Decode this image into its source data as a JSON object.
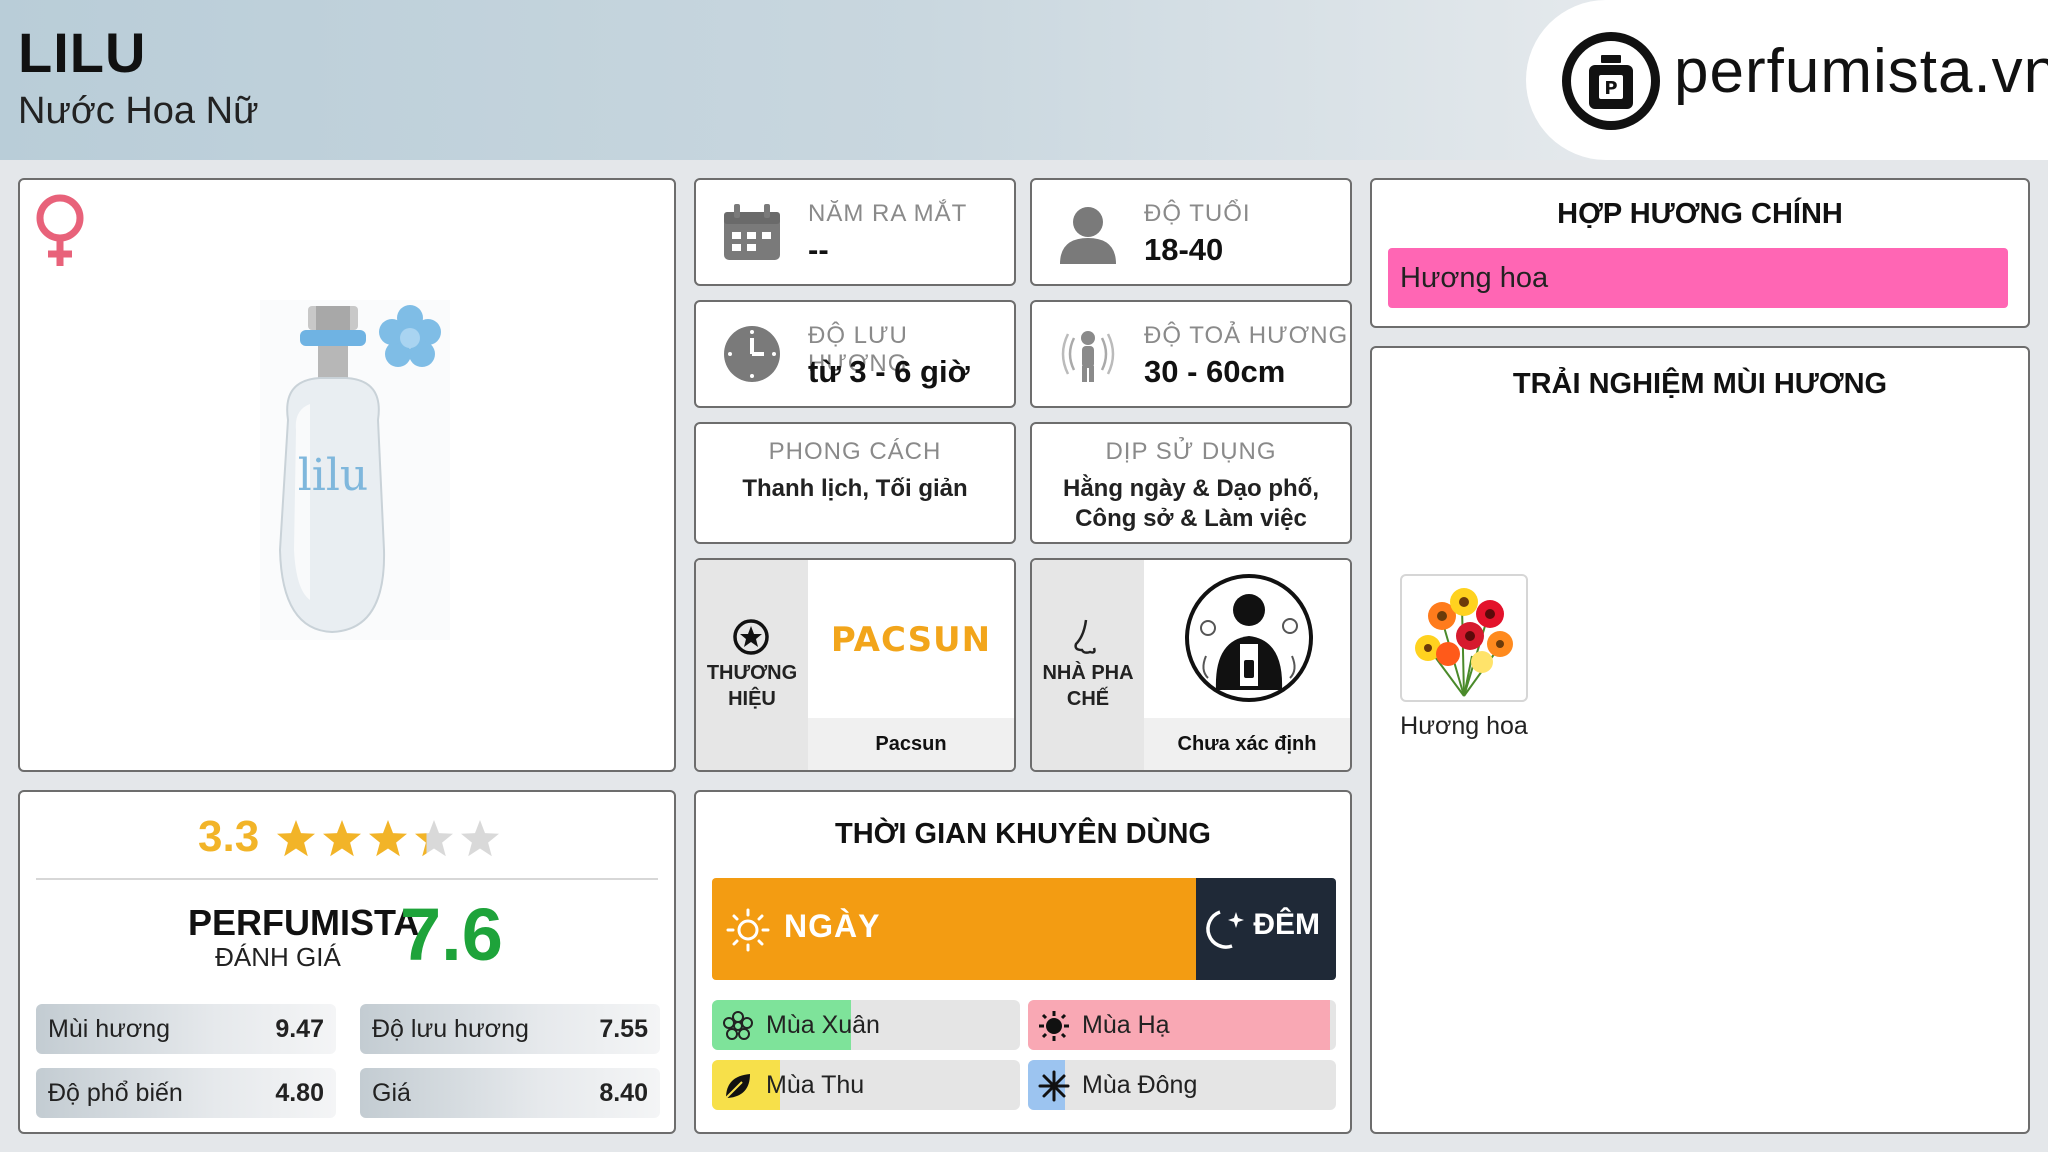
{
  "header": {
    "name": "LILU",
    "subtitle": "Nước Hoa Nữ",
    "logo_text": "perfumista.vn"
  },
  "product": {
    "gender_icon": "female-icon",
    "bottle_label": "lilu"
  },
  "info": {
    "launch": {
      "label": "NĂM RA MẮT",
      "value": "--"
    },
    "age": {
      "label": "ĐỘ TUỔI",
      "value": "18-40"
    },
    "longevity": {
      "label": "ĐỘ LƯU HƯƠNG",
      "value": "từ 3 - 6 giờ"
    },
    "sillage": {
      "label": "ĐỘ TOẢ HƯƠNG",
      "value": "30 - 60cm"
    },
    "style": {
      "label": "PHONG CÁCH",
      "value": "Thanh lịch, Tối giản"
    },
    "occasion": {
      "label": "DỊP SỬ DỤNG",
      "value": "Hằng ngày & Dạo phố, Công sở & Làm việc"
    },
    "brand": {
      "label": "THƯƠNG HIỆU",
      "logo_text": "PACSUN",
      "name": "Pacsun"
    },
    "perfumer": {
      "label": "NHÀ PHA CHẾ",
      "name": "Chưa xác định"
    }
  },
  "accords": {
    "title": "HỢP HƯƠNG CHÍNH",
    "items": [
      {
        "name": "Hương hoa",
        "color": "#ff66b4",
        "fraction": 1.0
      }
    ]
  },
  "experience": {
    "title": "TRẢI NGHIỆM MÙI HƯƠNG",
    "notes": [
      {
        "name": "Hương hoa"
      }
    ]
  },
  "rating": {
    "score": "3.3",
    "stars_value": 3.3,
    "stars_max": 5,
    "perfumista_label": "PERFUMISTA",
    "perfumista_sub": "ĐÁNH GIÁ",
    "perfumista_score": "7.6",
    "metrics": [
      {
        "label": "Mùi hương",
        "value": "9.47"
      },
      {
        "label": "Độ lưu hương",
        "value": "7.55"
      },
      {
        "label": "Độ phổ biến",
        "value": "4.80"
      },
      {
        "label": "Giá",
        "value": "8.40"
      }
    ]
  },
  "time": {
    "title": "THỜI GIAN KHUYÊN DÙNG",
    "day_label": "NGÀY",
    "night_label": "ĐÊM",
    "day_fraction": 0.775,
    "seasons": [
      {
        "label": "Mùa Xuân",
        "color": "#7ee39a",
        "fraction": 0.45
      },
      {
        "label": "Mùa Hạ",
        "color": "#f9a8b4",
        "fraction": 0.98
      },
      {
        "label": "Mùa Thu",
        "color": "#f7e04a",
        "fraction": 0.22
      },
      {
        "label": "Mùa Đông",
        "color": "#9cc4f0",
        "fraction": 0.12
      }
    ]
  },
  "colors": {
    "accent_gold": "#f2b428",
    "score_green": "#1ea33a",
    "day_orange": "#f39c12",
    "night_dark": "#1f2937"
  }
}
